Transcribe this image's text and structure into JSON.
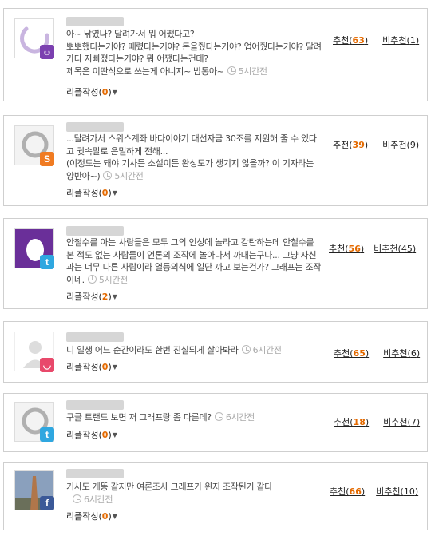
{
  "comments": [
    {
      "content": "아~ 낚였나? 달려가서 뭐 어쨌다고?\n뽀뽀했다는거야? 때렸다는거야? 돈을줬다는거야? 업어줬다는거야? 달려가다 자빠졌다는거야? 뭐 어쨌다는건데?\n제목은 이딴식으로 쓰는게 아니지~ 밥통아~",
      "time": "5시간전",
      "reply_label": "리플작성",
      "reply_count": "0",
      "up_label": "추천",
      "up_count": "63",
      "down_label": "비추천",
      "down_count": "1",
      "sns": "kakao"
    },
    {
      "content": "...달려가서 스위스계좌 바다이야기 대선자금 30조를 지원해 줄 수 있다고 귓속말로 은밀하게 전해...\n(이정도는 돼야 기사든 소설이든 완성도가 생기지 않을까? 이 기자라는 양반아~)",
      "time": "5시간전",
      "reply_label": "리플작성",
      "reply_count": "0",
      "up_label": "추천",
      "up_count": "39",
      "down_label": "비추천",
      "down_count": "9",
      "sns": "S"
    },
    {
      "content": "안철수를 아는 사람들은 모두 그의 인성에 놀라고 감탄하는데 안철수를 본 적도 없는 사람들이 언론의 조작에 놀아나서 까대는구나... 그냥 자신과는 너무 다른 사람이라 열등의식에 일단 까고 보는건가? 그래프는 조작이네.",
      "time": "5시간전",
      "reply_label": "리플작성",
      "reply_count": "2",
      "up_label": "추천",
      "up_count": "56",
      "down_label": "비추천",
      "down_count": "45",
      "sns": "twitter"
    },
    {
      "content": "니 일생 어느 순간이라도 한번 진실되게 살아봐라",
      "time": "6시간전",
      "reply_label": "리플작성",
      "reply_count": "0",
      "up_label": "추천",
      "up_count": "65",
      "down_label": "비추천",
      "down_count": "6",
      "sns": "me2day"
    },
    {
      "content": "구글 트랜드 보면 저 그래프랑 좀 다른데?",
      "time": "6시간전",
      "reply_label": "리플작성",
      "reply_count": "0",
      "up_label": "추천",
      "up_count": "18",
      "down_label": "비추천",
      "down_count": "7",
      "sns": "twitter"
    },
    {
      "content": "기사도 개똥 같지만 여론조사 그래프가 왼지 조작된거 같다",
      "time": "6시간전",
      "reply_label": "리플작성",
      "reply_count": "0",
      "up_label": "추천",
      "up_count": "66",
      "down_label": "비추천",
      "down_count": "10",
      "sns": "f"
    }
  ],
  "colors": {
    "count_orange": "#e46a00",
    "kakao": "#7b3fb0",
    "sns_s": "#f07b22",
    "twitter": "#2fa7e0",
    "me2day": "#e8496b",
    "facebook": "#3b5998"
  }
}
